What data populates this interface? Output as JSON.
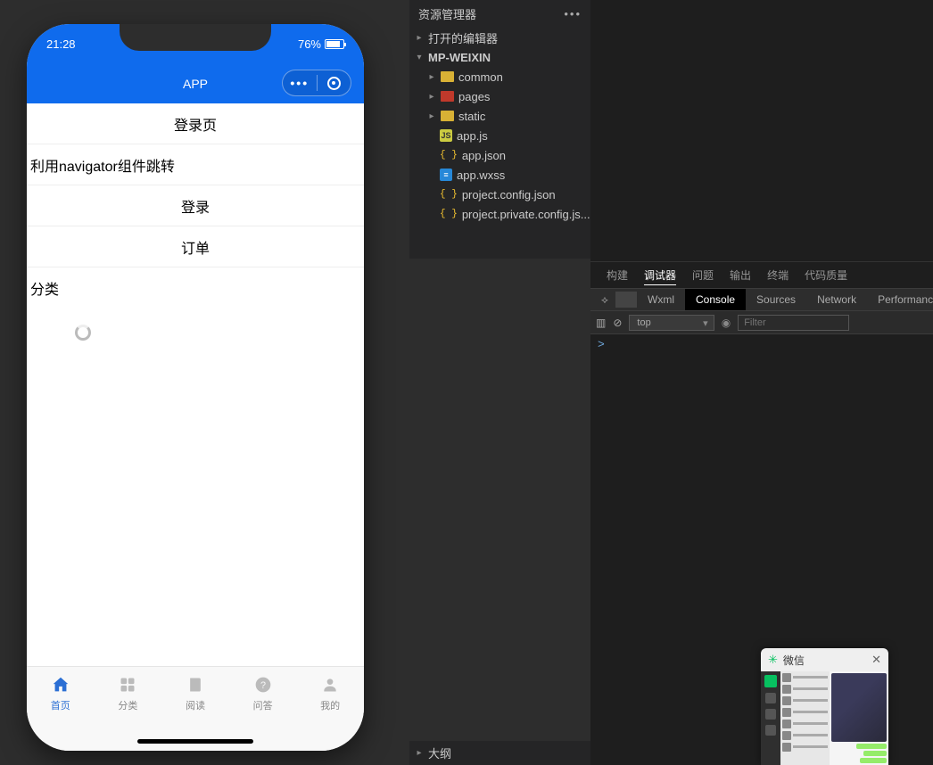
{
  "explorer": {
    "title": "资源管理器",
    "section_editors": "打开的编辑器",
    "project": "MP-WEIXIN",
    "outline": "大纲",
    "tree": [
      {
        "label": "common",
        "type": "folder-yellow"
      },
      {
        "label": "pages",
        "type": "folder-red"
      },
      {
        "label": "static",
        "type": "folder-yellow"
      },
      {
        "label": "app.js",
        "type": "js"
      },
      {
        "label": "app.json",
        "type": "json"
      },
      {
        "label": "app.wxss",
        "type": "wxss"
      },
      {
        "label": "project.config.json",
        "type": "json"
      },
      {
        "label": "project.private.config.js...",
        "type": "json"
      }
    ]
  },
  "phone": {
    "time": "21:28",
    "battery": "76%",
    "app_title": "APP",
    "rows": {
      "login_page": "登录页",
      "navigator_text": "利用navigator组件跳转",
      "login": "登录",
      "order": "订单",
      "category": "分类"
    },
    "tabs": [
      {
        "key": "home",
        "label": "首页"
      },
      {
        "key": "category",
        "label": "分类"
      },
      {
        "key": "read",
        "label": "阅读"
      },
      {
        "key": "qa",
        "label": "问答"
      },
      {
        "key": "mine",
        "label": "我的"
      }
    ]
  },
  "panel": {
    "tabs": {
      "build": "构建",
      "debugger": "调试器",
      "problems": "问题",
      "output": "输出",
      "terminal": "终端",
      "quality": "代码质量"
    }
  },
  "devtools": {
    "tabs": {
      "wxml": "Wxml",
      "console": "Console",
      "sources": "Sources",
      "network": "Network",
      "performance": "Performance"
    },
    "context": "top",
    "filter_placeholder": "Filter",
    "prompt": ">"
  },
  "wechat": {
    "title": "微信"
  }
}
